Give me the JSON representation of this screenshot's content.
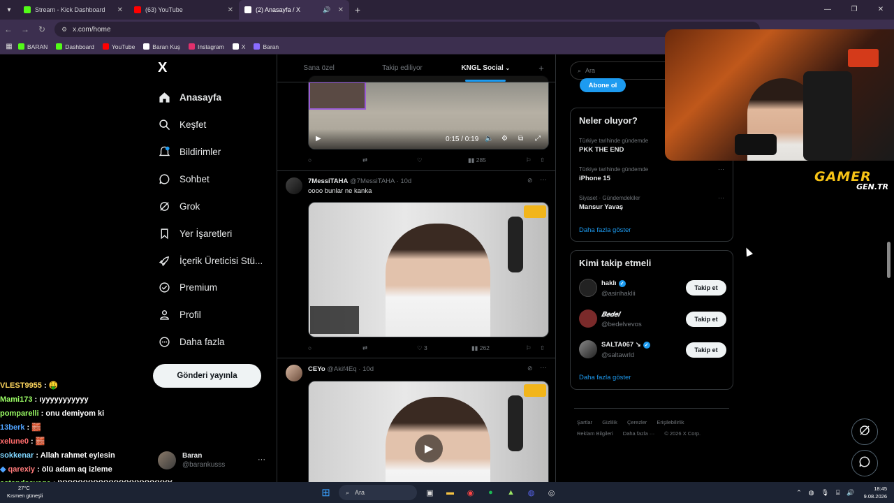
{
  "browser": {
    "tabs": [
      {
        "title": "Stream - Kick Dashboard",
        "color": "#53fc18"
      },
      {
        "title": "(63) YouTube",
        "color": "#ff0000"
      },
      {
        "title": "(2) Anasayfa / X",
        "color": "#ffffff"
      }
    ],
    "url": "x.com/home",
    "bookmarks": [
      {
        "label": "BARAN",
        "color": "#53fc18"
      },
      {
        "label": "Dashboard",
        "color": "#53fc18"
      },
      {
        "label": "YouTube",
        "color": "#ff0000"
      },
      {
        "label": "Baran Kuş",
        "color": "#ffffff"
      },
      {
        "label": "Instagram",
        "color": "#e1306c"
      },
      {
        "label": "X",
        "color": "#ffffff"
      },
      {
        "label": "Baran",
        "color": "#8a6cff"
      }
    ]
  },
  "nav": {
    "logo": "X",
    "items": [
      {
        "label": "Anasayfa",
        "icon": "home-icon"
      },
      {
        "label": "Keşfet",
        "icon": "search-icon"
      },
      {
        "label": "Bildirimler",
        "icon": "bell-icon"
      },
      {
        "label": "Sohbet",
        "icon": "chat-icon"
      },
      {
        "label": "Grok",
        "icon": "grok-icon"
      },
      {
        "label": "Yer İşaretleri",
        "icon": "bookmark-icon"
      },
      {
        "label": "İçerik Üreticisi Stü...",
        "icon": "rocket-icon"
      },
      {
        "label": "Premium",
        "icon": "premium-icon"
      },
      {
        "label": "Profil",
        "icon": "profile-icon"
      },
      {
        "label": "Daha fazla",
        "icon": "more-icon"
      }
    ],
    "post_button": "Gönderi yayınla",
    "account": {
      "name": "Baran",
      "handle": "@barankusss"
    }
  },
  "timeline": {
    "tabs": [
      "Sana özel",
      "Takip ediliyor",
      "KNGL Social"
    ],
    "video_time": "0:15 / 0:19",
    "tweet1_views": "285",
    "tweet2": {
      "name": "7MessiTAHA",
      "handle": "@7MessiTAHA",
      "time": "10d",
      "text": "oooo bunlar ne kanka",
      "likes": "3",
      "views": "262"
    },
    "tweet3": {
      "name": "CEYo",
      "handle": "@Akif4Eq",
      "time": "10d"
    }
  },
  "sidebar": {
    "search_placeholder": "Ara",
    "subscribe": "Abone ol",
    "trending_title": "Neler oluyor?",
    "trends": [
      {
        "category": "Türkiye tarihinde gündemde",
        "name": "PKK THE END"
      },
      {
        "category": "Türkiye tarihinde gündemde",
        "name": "iPhone 15"
      },
      {
        "category": "Siyaset · Gündemdekiler",
        "name": "Mansur Yavaş"
      }
    ],
    "show_more": "Daha fazla göster",
    "wtf_title": "Kimi takip etmeli",
    "who_to_follow": [
      {
        "name": "haklı",
        "handle": "@asirihaklii",
        "verified": true,
        "avatar_color": "#222222"
      },
      {
        "name": "𝑩𝒆𝒅𝒆𝒍",
        "handle": "@bedelvevos",
        "verified": false,
        "avatar_color": "#7a2a2a"
      },
      {
        "name": "SALTA067 ↘",
        "handle": "@saltawrld",
        "verified": true,
        "avatar_color": "#555555"
      }
    ],
    "follow_label": "Takip et",
    "footer": [
      "Şartlar",
      "Gizlilik",
      "Çerezler",
      "Erişilebilirlik",
      "Reklam Bilgileri",
      "Daha fazla ···",
      "© 2026 X Corp."
    ]
  },
  "overlay": {
    "brand_line1": "GAMER",
    "brand_line2": "GEN.TR",
    "chat": [
      {
        "user": "VLEST9955",
        "msg": "🤑",
        "color": "#ffd75e"
      },
      {
        "user": "Mami173",
        "msg": "ıyyyyyyyyyyy",
        "color": "#9cff66"
      },
      {
        "user": "pomparelli",
        "msg": "onu demiyom ki",
        "color": "#9cff66"
      },
      {
        "user": "13berk",
        "msg": "🧱",
        "color": "#4fa3ff"
      },
      {
        "user": "xelune0",
        "msg": "🧱",
        "color": "#ff6b6b"
      },
      {
        "user": "sokkenar",
        "msg": "Allah rahmet eylesin",
        "color": "#7fd6ff"
      },
      {
        "user": "qarexiy",
        "msg": "ölü adam aq izleme",
        "color": "#ff7a7a"
      },
      {
        "user": "astendsavage",
        "msg": "IYYYYYYYYYYYYYYYYYYYYYY",
        "color": "#9cff66"
      }
    ]
  },
  "taskbar": {
    "weather_temp": "27°C",
    "weather_text": "Kısmen güneşli",
    "search": "Ara",
    "time": "18:45",
    "date": "9.08.2026"
  }
}
